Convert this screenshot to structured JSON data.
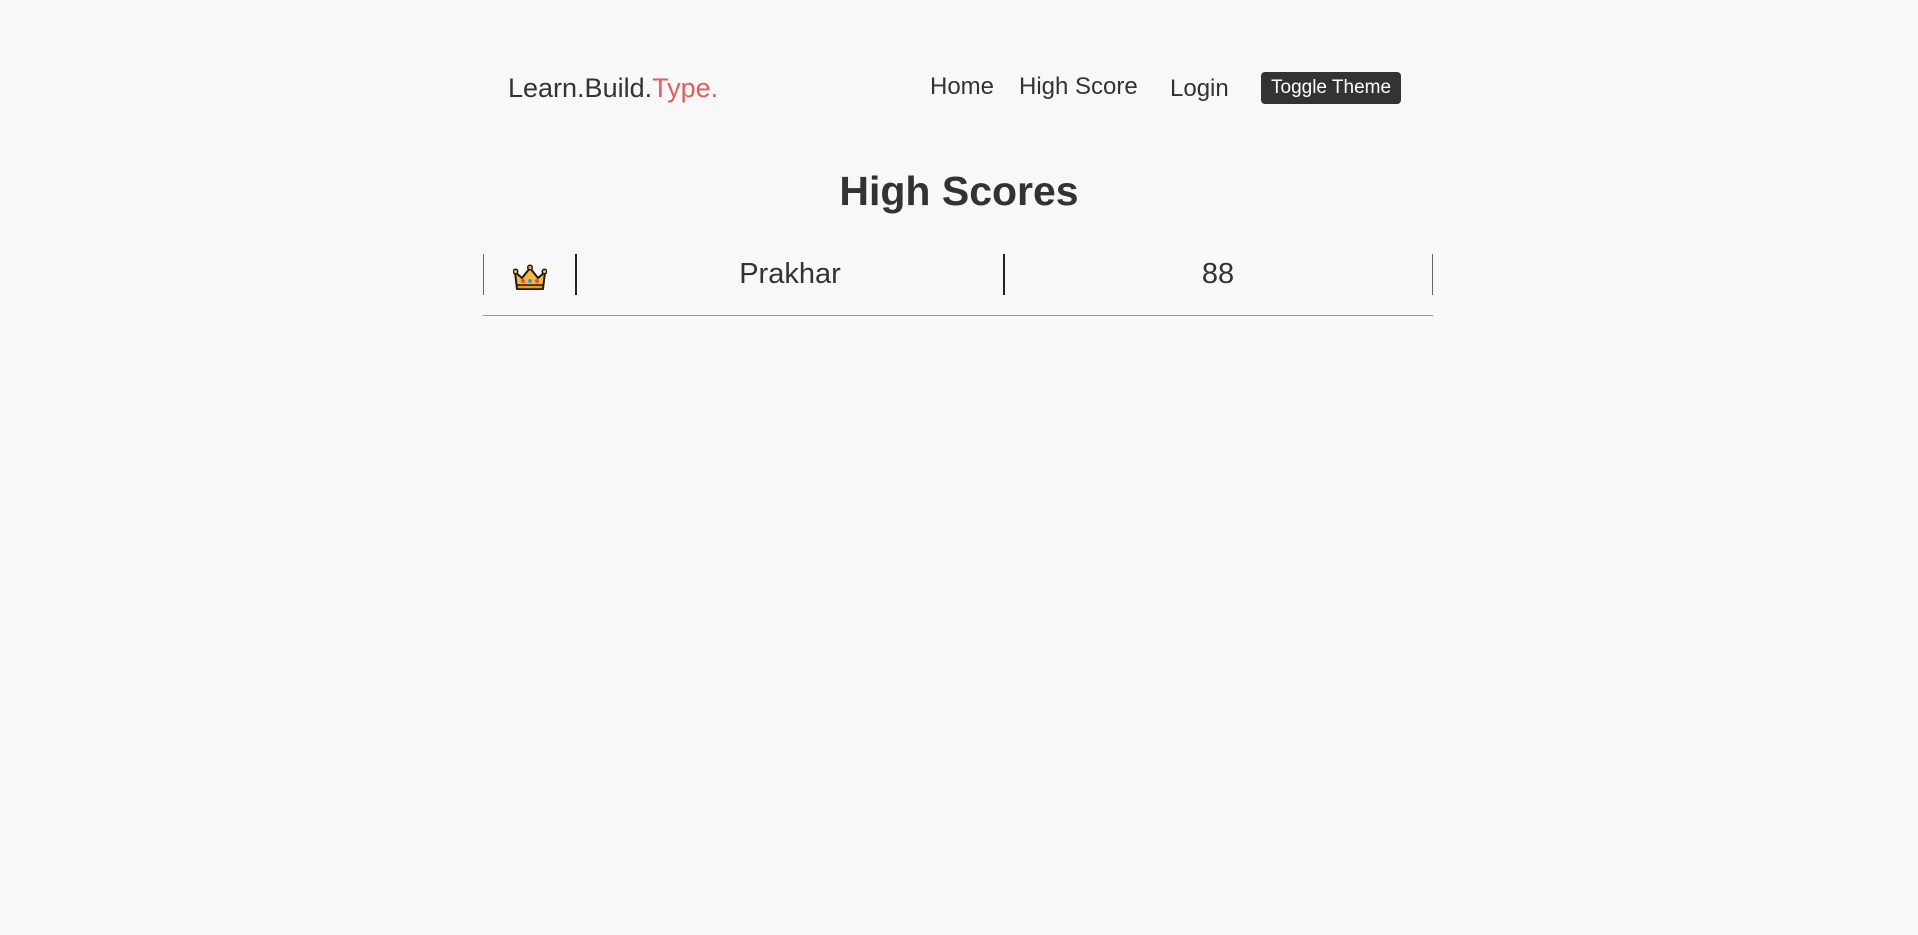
{
  "navbar": {
    "brand": {
      "part1": "Learn.Build.",
      "part2": "Type."
    },
    "links": [
      {
        "label": "Home"
      },
      {
        "label": "High Score"
      },
      {
        "label": "Login"
      }
    ],
    "toggle_theme_label": "Toggle Theme"
  },
  "page": {
    "title": "High Scores"
  },
  "scores": {
    "rows": [
      {
        "rank_icon": "crown-icon",
        "name": "Prakhar",
        "score": "88"
      }
    ]
  },
  "colors": {
    "background": "#f8f8f8",
    "text": "#333333",
    "brand_accent": "#e05d5d",
    "button_bg": "#333333",
    "button_text": "#ffffff"
  }
}
